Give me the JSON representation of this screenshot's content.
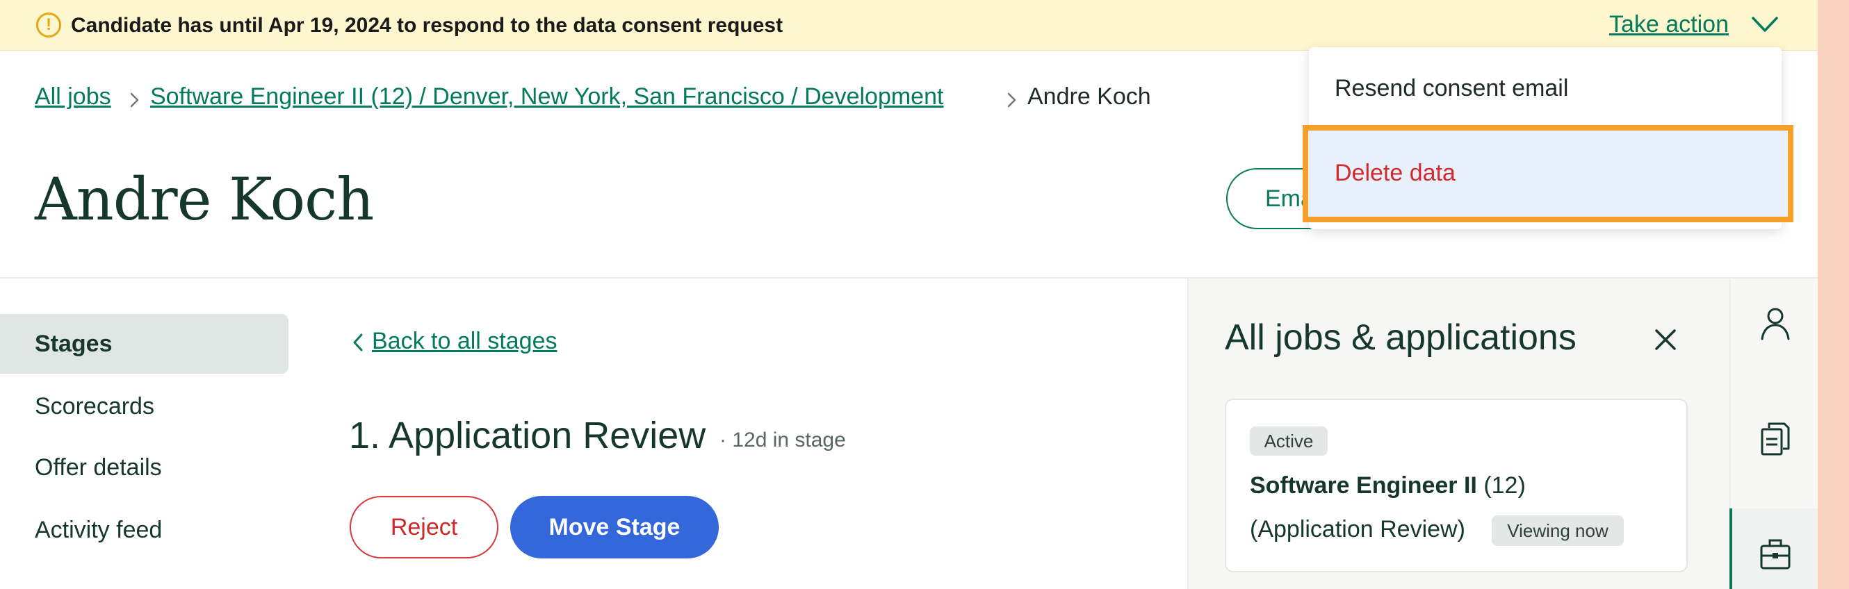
{
  "banner": {
    "alert_icon": "!",
    "message": "Candidate has until Apr 19, 2024 to respond to the data consent request",
    "take_action": "Take action"
  },
  "breadcrumb": {
    "all_jobs": "All jobs",
    "job": "Software Engineer II (12) / Denver, New York, San Francisco / Development",
    "current": "Andre Koch"
  },
  "candidate": {
    "name": "Andre Koch",
    "email_button": "Email"
  },
  "nav": {
    "items": [
      "Stages",
      "Scorecards",
      "Offer details",
      "Activity feed"
    ],
    "active": "Stages"
  },
  "stage": {
    "back_link": "Back to all stages",
    "title": "1. Application Review",
    "time_in_stage": "· 12d in stage",
    "reject_label": "Reject",
    "move_label": "Move Stage"
  },
  "panel": {
    "title": "All jobs & applications",
    "card": {
      "status_badge": "Active",
      "job_title": "Software Engineer II",
      "job_count": "(12)",
      "stage": "(Application Review)",
      "viewing_badge": "Viewing now"
    }
  },
  "dropdown": {
    "items": [
      "Resend consent email",
      "Delete data"
    ]
  },
  "colors": {
    "accent": "#047a5c",
    "banner_bg": "#fdf6cf",
    "primary_button": "#3467d9",
    "danger": "#d12b2b",
    "highlight": "#f5a02a"
  },
  "icons": [
    "alert-icon",
    "chevron-down-icon",
    "chevron-right-icon",
    "chevron-left-icon",
    "close-icon",
    "person-icon",
    "documents-icon",
    "briefcase-icon"
  ]
}
